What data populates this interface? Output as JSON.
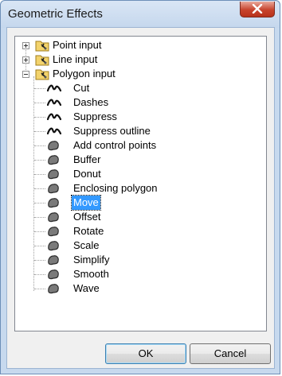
{
  "dialog": {
    "title": "Geometric Effects",
    "close_label": "✕"
  },
  "tree": {
    "groups": [
      {
        "label": "Point input",
        "expanded": false
      },
      {
        "label": "Line input",
        "expanded": false
      },
      {
        "label": "Polygon input",
        "expanded": true
      }
    ],
    "line_effects": [
      "Cut",
      "Dashes",
      "Suppress",
      "Suppress outline"
    ],
    "polygon_effects": [
      "Add control points",
      "Buffer",
      "Donut",
      "Enclosing polygon",
      "Move",
      "Offset",
      "Rotate",
      "Scale",
      "Simplify",
      "Smooth",
      "Wave"
    ],
    "selected": "Move"
  },
  "buttons": {
    "ok": "OK",
    "cancel": "Cancel"
  },
  "colors": {
    "selection": "#3399ff",
    "close_button": "#c7432c",
    "frame": "#c7d9ee"
  }
}
